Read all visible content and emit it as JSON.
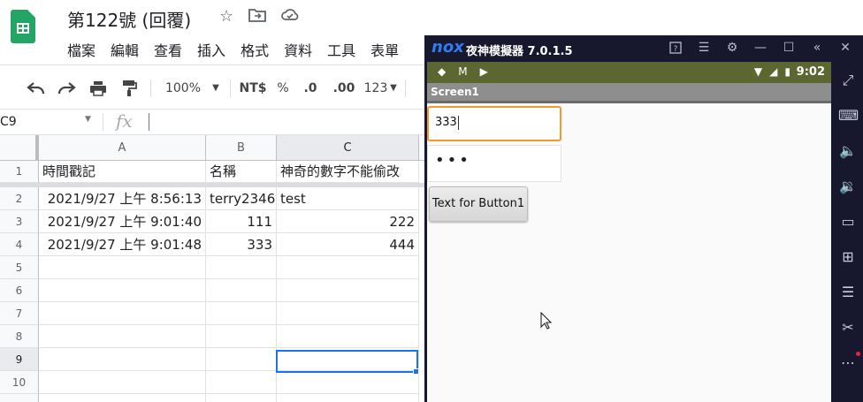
{
  "sheets": {
    "doc_title": "第122號 (回覆)",
    "menu": [
      "檔案",
      "編輯",
      "查看",
      "插入",
      "格式",
      "資料",
      "工具",
      "表單"
    ],
    "toolbar": {
      "zoom": "100%",
      "currency": "NT$",
      "percent": "%",
      "dec_decrease": ".0",
      "dec_increase": ".00",
      "format_more": "123"
    },
    "name_box": "C9",
    "fx": "fx",
    "columns": [
      "A",
      "B",
      "C"
    ],
    "header_row": [
      "時間戳記",
      "名稱",
      "神奇的數字不能偷改"
    ],
    "rows": [
      [
        "2021/9/27 上午 8:56:13",
        "terry2346",
        "test"
      ],
      [
        "2021/9/27 上午 9:01:40",
        "111",
        "222"
      ],
      [
        "2021/9/27 上午 9:01:48",
        "333",
        "444"
      ]
    ],
    "row_numbers": [
      "1",
      "2",
      "3",
      "4",
      "5",
      "6",
      "7",
      "8",
      "9",
      "10"
    ],
    "selected_cell": "C9",
    "accent_color": "#1a73e8",
    "brand_color": "#23a566"
  },
  "nox": {
    "logo": "nox",
    "title": "夜神模擬器 7.0.1.5",
    "status_time": "9:02",
    "screen_title": "Screen1",
    "textbox1_value": "333",
    "password_mask": "•••",
    "button1_label": "Text for Button1",
    "statusbar_color": "#5b6630",
    "focus_color": "#f29b2a"
  }
}
